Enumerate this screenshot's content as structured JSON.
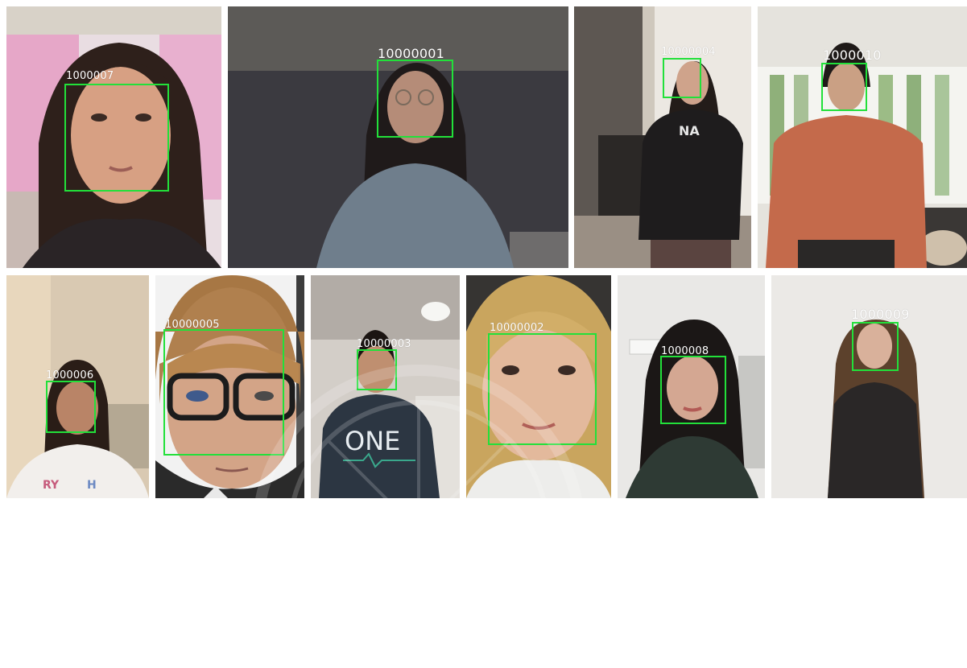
{
  "image": {
    "colors": {
      "box_stroke": "#22e03a",
      "label_text": "#ffffff",
      "separator": "#ffffff"
    },
    "top_row": [
      {
        "id": "1000007"
      },
      {
        "id": "10000001"
      },
      {
        "id": "10000004"
      },
      {
        "id": "1000010"
      }
    ],
    "bottom_row": [
      {
        "id": "1000006"
      },
      {
        "id": "10000005"
      },
      {
        "id": "10000003"
      },
      {
        "id": "10000002"
      },
      {
        "id": "1000008"
      },
      {
        "id": "1000009"
      }
    ],
    "shirt_print": "ONE"
  }
}
